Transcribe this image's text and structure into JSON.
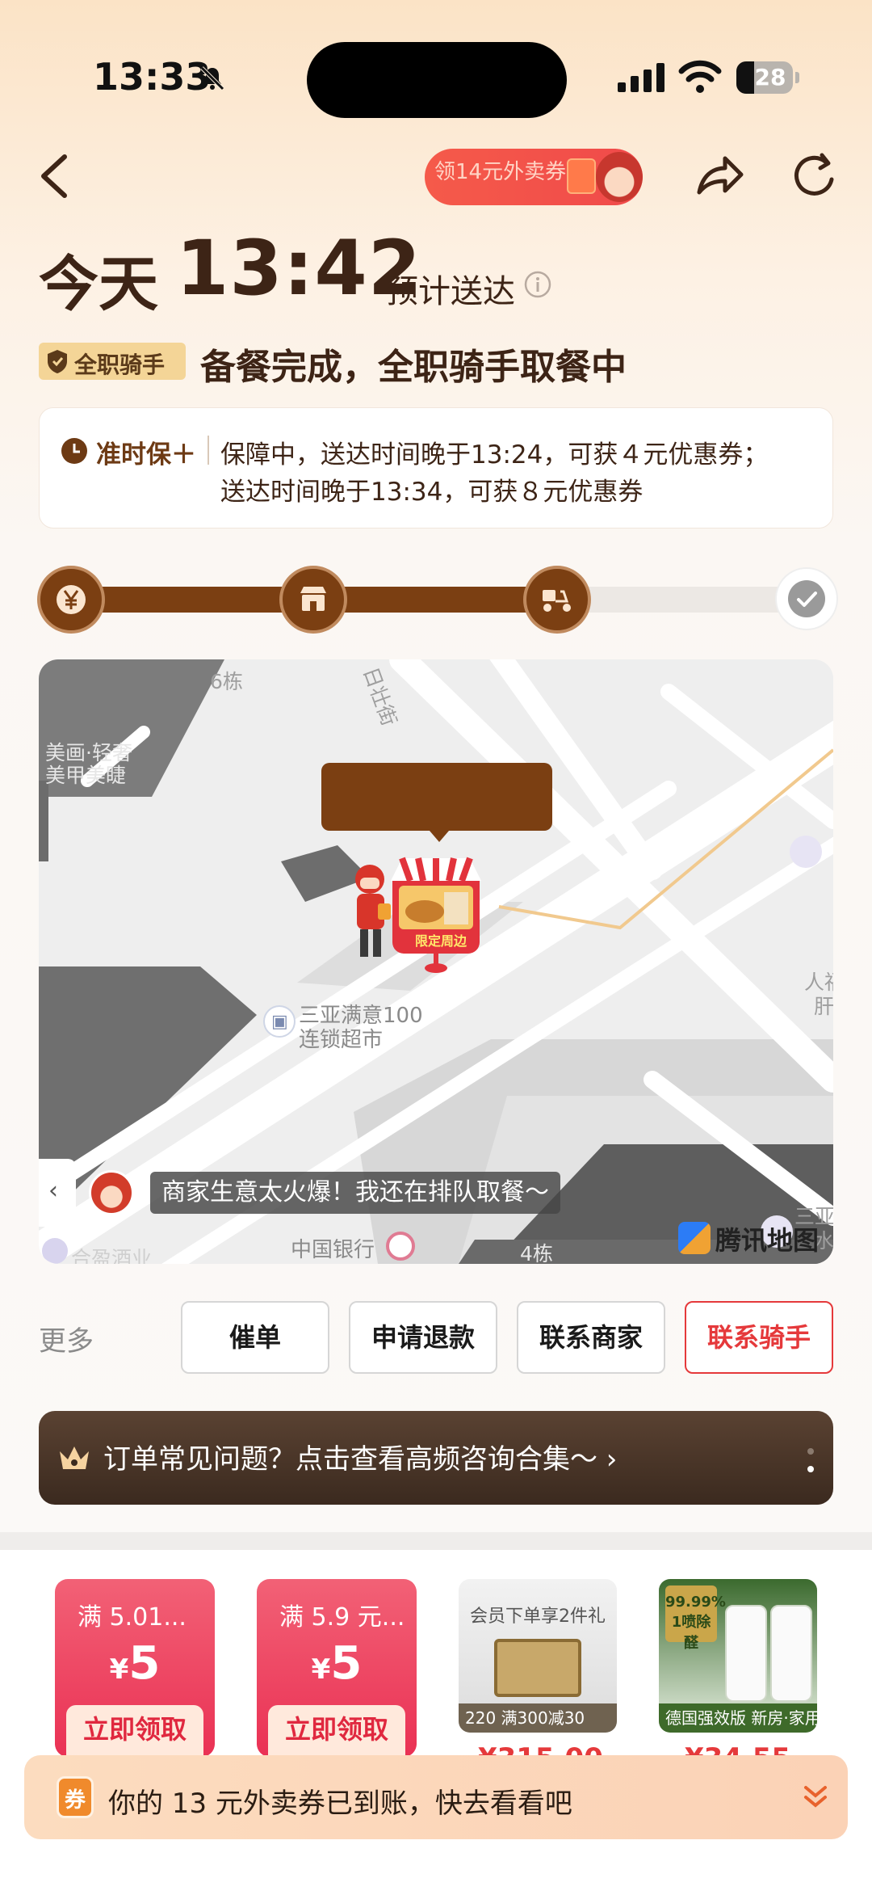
{
  "status_bar": {
    "time": "13:33",
    "battery": "28"
  },
  "nav": {
    "promo_text": "领14元外卖券"
  },
  "eta": {
    "day": "今天",
    "time": "13:42",
    "label": "预计送达"
  },
  "rider_badge": "全职骑手",
  "order_status": "备餐完成，全职骑手取餐中",
  "ontime": {
    "title": "准时保＋",
    "line1": "保障中，送达时间晚于13:24，可获４元优惠券；",
    "line2": "送达时间晚于13:34，可获８元优惠券"
  },
  "progress": {
    "completed_steps": 3,
    "total_steps": 4,
    "fill_fraction": 0.66
  },
  "map": {
    "labels": {
      "building6": "6栋",
      "street": "日壮街",
      "shop_left_1": "美画·轻奢",
      "shop_left_2": "美甲美睫",
      "market_1": "三亚满意100",
      "market_2": "连锁超市",
      "bank": "中国银行",
      "building4": "4栋",
      "hotel": "合盈酒业",
      "right_edge_1": "人福",
      "right_edge_2": "肝",
      "right_edge_3": "三亚",
      "right_edge_4": "水"
    },
    "store_sign": "限定周边",
    "rider_message": "商家生意太火爆！我还在排队取餐～",
    "provider": "腾讯地图"
  },
  "actions": {
    "more": "更多",
    "buttons": [
      "催单",
      "申请退款",
      "联系商家",
      "联系骑手"
    ]
  },
  "faq": {
    "text": "订单常见问题？点击查看高频咨询合集～ ›"
  },
  "recommend": {
    "coupons": [
      {
        "condition": "满 5.01...",
        "currency": "¥",
        "value": "5",
        "claim": "立即领取"
      },
      {
        "condition": "满 5.9 元...",
        "currency": "¥",
        "value": "5",
        "claim": "立即领取"
      }
    ],
    "products": [
      {
        "title": "会员下单享2件礼",
        "caption": "220 满300减30",
        "price": "¥315.00"
      },
      {
        "title": "",
        "caption": "德国强效版 新房·家用·急入住",
        "badge": "99.99% 1喷除醛",
        "price": "¥34.55"
      }
    ]
  },
  "toast": {
    "icon": "券",
    "text": "你的 13 元外卖券已到账，快去看看吧"
  },
  "colors": {
    "brand_brown": "#7b3f12",
    "accent_red": "#e5393b",
    "coupon_pink": "#ea3154"
  },
  "icons": [
    "bell-slash-icon",
    "signal-icon",
    "wifi-icon",
    "battery-icon",
    "back-arrow-icon",
    "share-icon",
    "refresh-icon",
    "info-icon",
    "shield-icon",
    "clock-icon",
    "yuan-icon",
    "store-icon",
    "scooter-icon",
    "check-icon",
    "crown-icon",
    "chevron-down-icon"
  ]
}
